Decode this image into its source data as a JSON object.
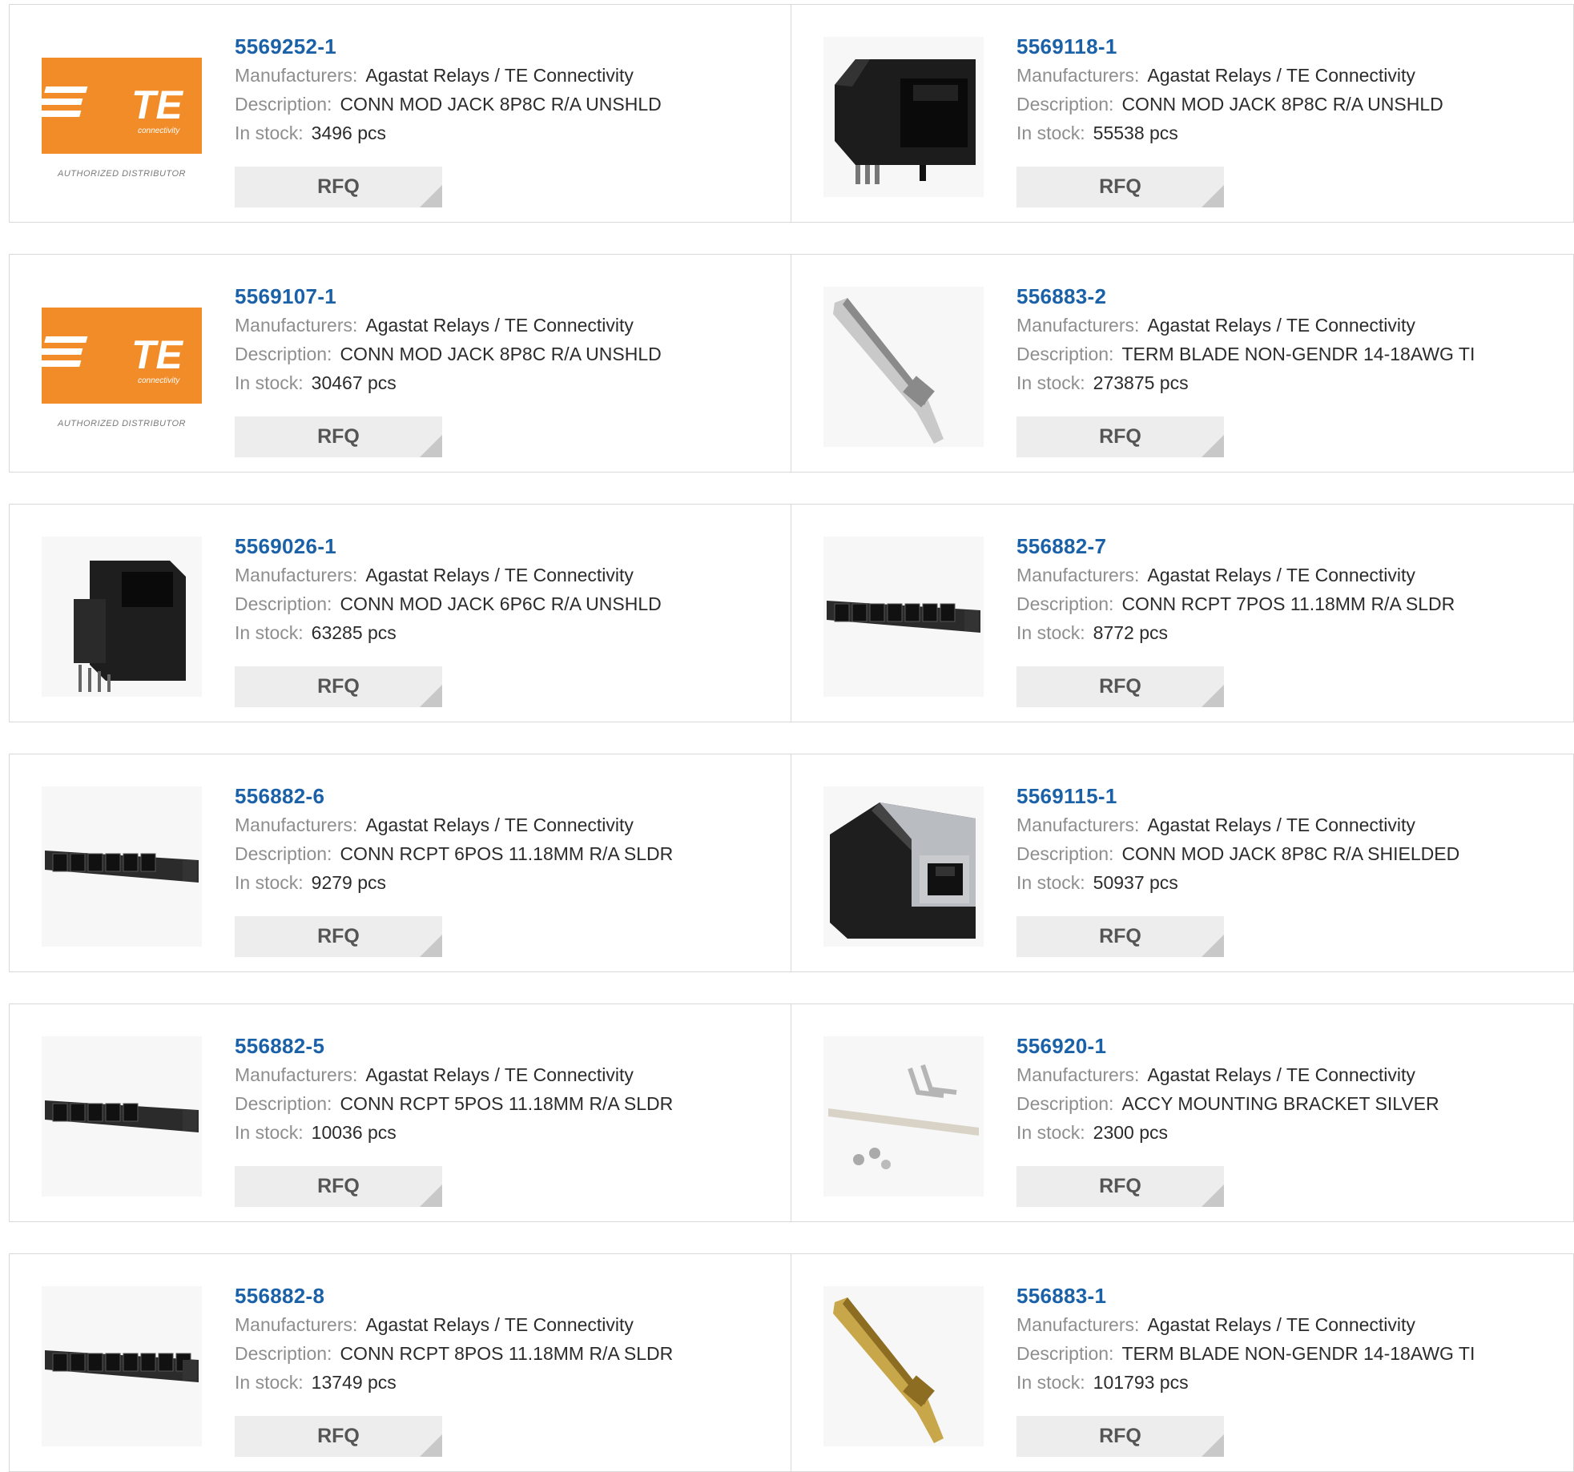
{
  "labels": {
    "manufacturers": "Manufacturers:",
    "description": "Description:",
    "stock": "In stock:",
    "rfq": "RFQ"
  },
  "colors": {
    "part_link": "#1a61a8",
    "label": "#8e8e8e",
    "value": "#2b2b2b",
    "te_orange": "#f28c28",
    "rfq_bg": "#ededed"
  },
  "logo": {
    "brand": "TE",
    "sub": "connectivity",
    "caption": "AUTHORIZED DISTRIBUTOR"
  },
  "products": [
    {
      "part": "5569252-1",
      "manufacturer": "Agastat Relays / TE Connectivity",
      "description": "CONN MOD JACK 8P8C R/A UNSHLD",
      "stock": "3496 pcs",
      "image": "te-logo"
    },
    {
      "part": "5569118-1",
      "manufacturer": "Agastat Relays / TE Connectivity",
      "description": "CONN MOD JACK 8P8C R/A UNSHLD",
      "stock": "55538 pcs",
      "image": "modular-jack-black"
    },
    {
      "part": "5569107-1",
      "manufacturer": "Agastat Relays / TE Connectivity",
      "description": "CONN MOD JACK 8P8C R/A UNSHLD",
      "stock": "30467 pcs",
      "image": "te-logo"
    },
    {
      "part": "556883-2",
      "manufacturer": "Agastat Relays / TE Connectivity",
      "description": "TERM BLADE NON-GENDR 14-18AWG TI",
      "stock": "273875 pcs",
      "image": "blade-terminal-silver"
    },
    {
      "part": "5569026-1",
      "manufacturer": "Agastat Relays / TE Connectivity",
      "description": "CONN MOD JACK 6P6C R/A UNSHLD",
      "stock": "63285 pcs",
      "image": "modular-jack-vertical"
    },
    {
      "part": "556882-7",
      "manufacturer": "Agastat Relays / TE Connectivity",
      "description": "CONN RCPT 7POS 11.18MM R/A SLDR",
      "stock": "8772 pcs",
      "image": "receptacle-strip-7"
    },
    {
      "part": "556882-6",
      "manufacturer": "Agastat Relays / TE Connectivity",
      "description": "CONN RCPT 6POS 11.18MM R/A SLDR",
      "stock": "9279 pcs",
      "image": "receptacle-strip-6"
    },
    {
      "part": "5569115-1",
      "manufacturer": "Agastat Relays / TE Connectivity",
      "description": "CONN MOD JACK 8P8C R/A SHIELDED",
      "stock": "50937 pcs",
      "image": "modular-jack-shielded"
    },
    {
      "part": "556882-5",
      "manufacturer": "Agastat Relays / TE Connectivity",
      "description": "CONN RCPT 5POS 11.18MM R/A SLDR",
      "stock": "10036 pcs",
      "image": "receptacle-strip-5"
    },
    {
      "part": "556920-1",
      "manufacturer": "Agastat Relays / TE Connectivity",
      "description": "ACCY MOUNTING BRACKET SILVER",
      "stock": "2300 pcs",
      "image": "mounting-bracket-kit"
    },
    {
      "part": "556882-8",
      "manufacturer": "Agastat Relays / TE Connectivity",
      "description": "CONN RCPT 8POS 11.18MM R/A SLDR",
      "stock": "13749 pcs",
      "image": "receptacle-strip-8"
    },
    {
      "part": "556883-1",
      "manufacturer": "Agastat Relays / TE Connectivity",
      "description": "TERM BLADE NON-GENDR 14-18AWG TI",
      "stock": "101793 pcs",
      "image": "blade-terminal-gold"
    }
  ]
}
